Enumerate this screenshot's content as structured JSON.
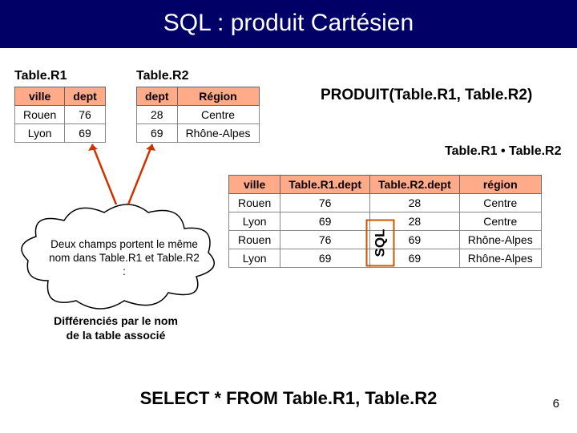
{
  "title": "SQL : produit Cartésien",
  "r1": {
    "label": "Table.R1",
    "headers": [
      "ville",
      "dept"
    ],
    "rows": [
      [
        "Rouen",
        "76"
      ],
      [
        "Lyon",
        "69"
      ]
    ]
  },
  "r2": {
    "label": "Table.R2",
    "headers": [
      "dept",
      "Région"
    ],
    "rows": [
      [
        "28",
        "Centre"
      ],
      [
        "69",
        "Rhône-Alpes"
      ]
    ]
  },
  "produit_label": "PRODUIT(Table.R1, Table.R2)",
  "result_label": "Table.R1 • Table.R2",
  "result": {
    "headers": [
      "ville",
      "Table.R1.dept",
      "Table.R2.dept",
      "région"
    ],
    "rows": [
      [
        "Rouen",
        "76",
        "28",
        "Centre"
      ],
      [
        "Lyon",
        "69",
        "28",
        "Centre"
      ],
      [
        "Rouen",
        "76",
        "69",
        "Rhône-Alpes"
      ],
      [
        "Lyon",
        "69",
        "69",
        "Rhône-Alpes"
      ]
    ]
  },
  "cloud_text": "Deux champs portent le même nom dans Table.R1 et Table.R2 :",
  "diff_text": "Différenciés par le nom de la table associé",
  "sql_label": "SQL",
  "select_stmt": "SELECT * FROM Table.R1, Table.R2",
  "page_num": "6"
}
